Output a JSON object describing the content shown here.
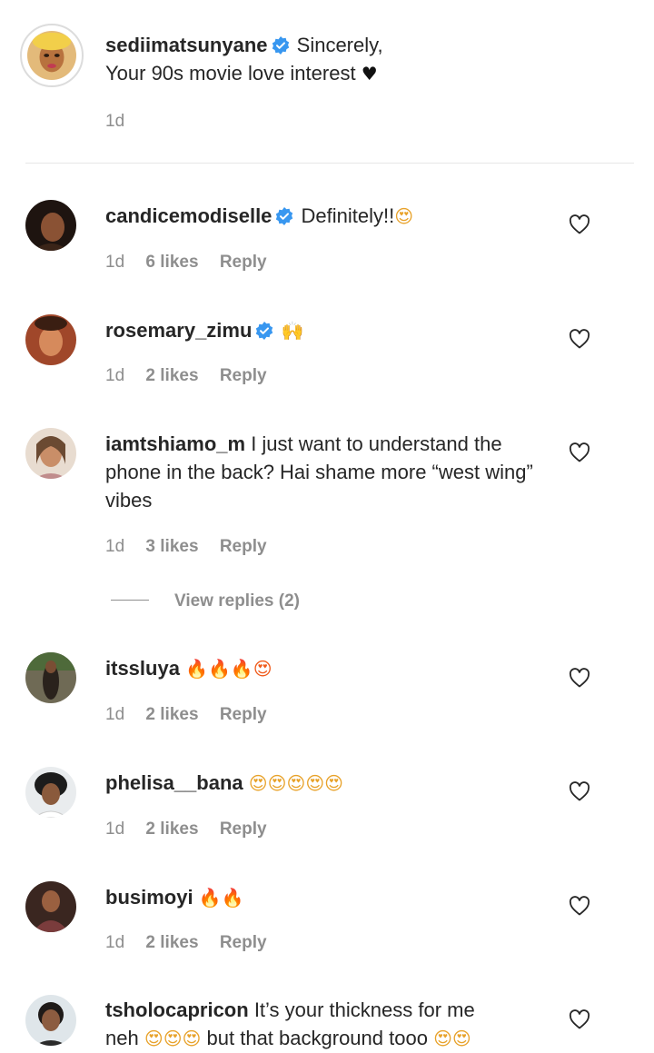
{
  "caption": {
    "username": "sediimatsunyane",
    "verified": true,
    "text_line1": "Sincerely,",
    "text_line2": "Your 90s movie love interest",
    "emoji": "♥",
    "time": "1d"
  },
  "comments": [
    {
      "username": "candicemodiselle",
      "verified": true,
      "text": "Definitely!!",
      "emoji": "😍",
      "time": "1d",
      "likes": "6 likes",
      "reply": "Reply"
    },
    {
      "username": "rosemary_zimu",
      "verified": true,
      "text": "",
      "emoji": "🙌",
      "time": "1d",
      "likes": "2 likes",
      "reply": "Reply"
    },
    {
      "username": "iamtshiamo_m",
      "verified": false,
      "text": "I just want to understand the phone in the back? Hai shame more “west wing” vibes",
      "time": "1d",
      "likes": "3 likes",
      "reply": "Reply",
      "view_replies": "View replies (2)"
    },
    {
      "username": "itssluya",
      "verified": false,
      "text": "",
      "emoji": "🔥🔥🔥😍",
      "time": "1d",
      "likes": "2 likes",
      "reply": "Reply"
    },
    {
      "username": "phelisa__bana",
      "verified": false,
      "text": "",
      "emoji": "😍😍😍😍😍",
      "time": "1d",
      "likes": "2 likes",
      "reply": "Reply"
    },
    {
      "username": "busimoyi",
      "verified": false,
      "text": "",
      "emoji": "🔥🔥",
      "time": "1d",
      "likes": "2 likes",
      "reply": "Reply"
    },
    {
      "username": "tsholocapricon",
      "verified": false,
      "text1": "It’s your thickness for me",
      "text2a": "neh",
      "emoji2a": "😍😍😍",
      "text2b": "but that background tooo",
      "emoji2b": "😍😍"
    }
  ],
  "colors": {
    "text": "#262626",
    "secondary": "#8e8e8e",
    "verified": "#3897f0",
    "divider": "#e6e6e6"
  },
  "icons": {
    "verified": "verified-badge-icon",
    "like": "heart-outline-icon"
  }
}
